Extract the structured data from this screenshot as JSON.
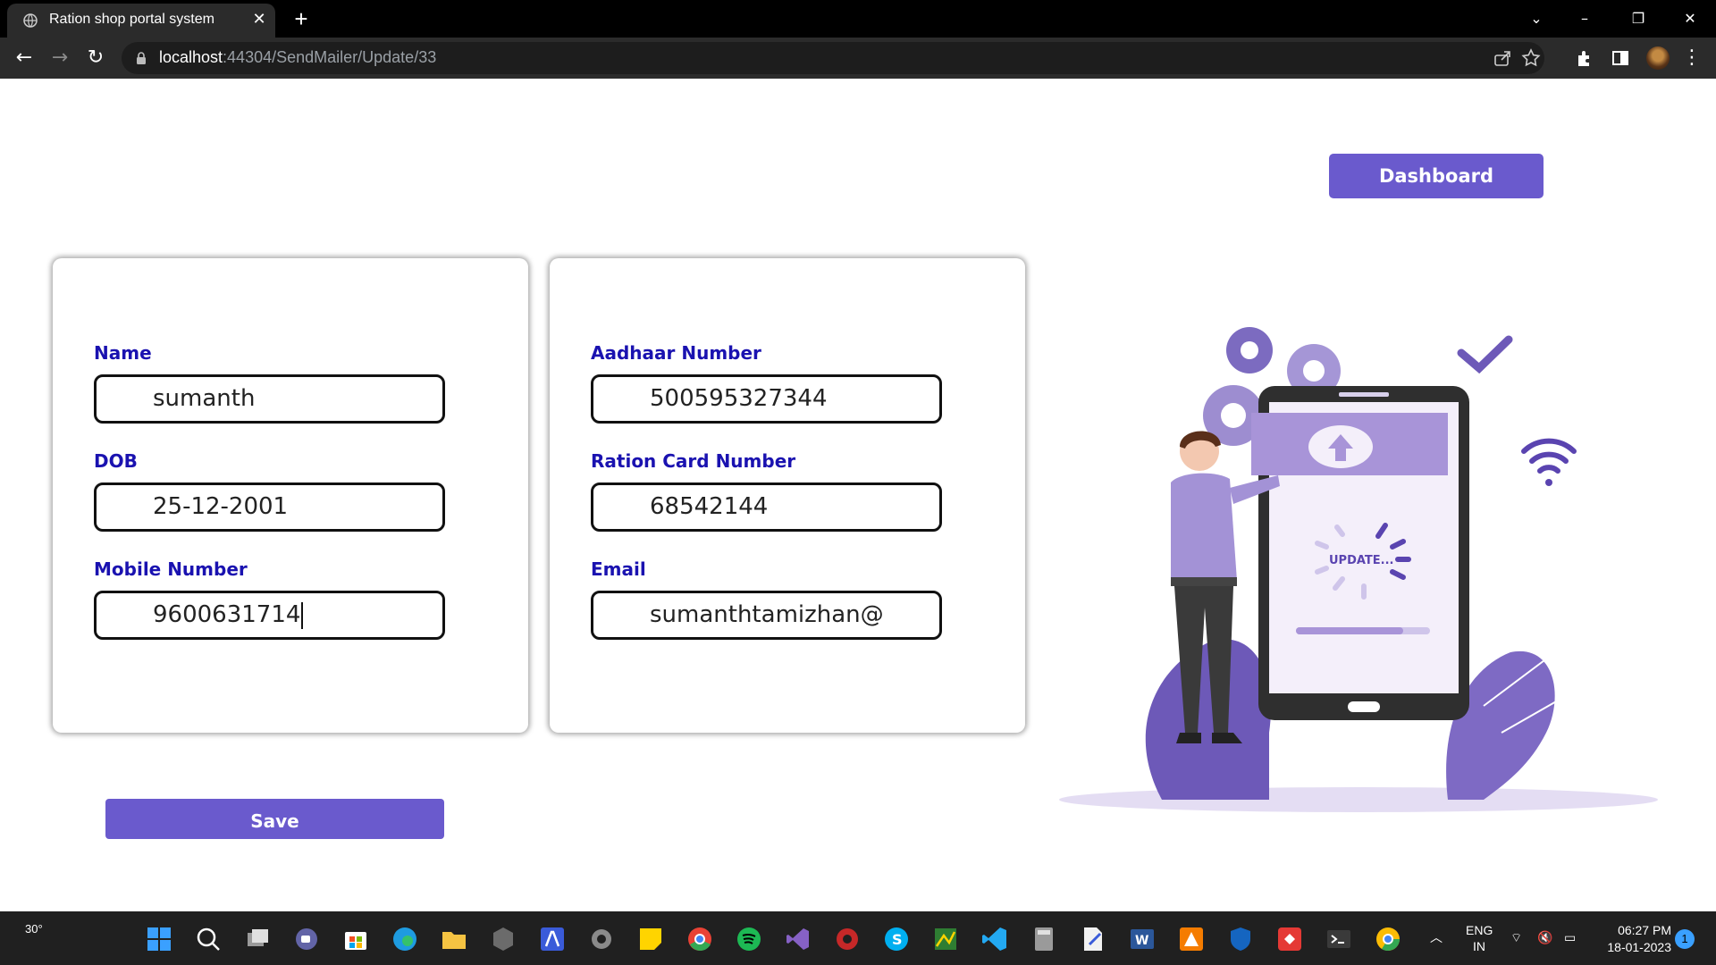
{
  "browser": {
    "tab_title": "Ration shop portal system",
    "url_host": "localhost",
    "url_rest": ":44304/SendMailer/Update/33"
  },
  "page": {
    "dashboard_label": "Dashboard",
    "save_label": "Save",
    "illustration_text": "UPDATE...",
    "left_card": {
      "name_label": "Name",
      "name_value": "sumanth",
      "dob_label": "DOB",
      "dob_value": "25-12-2001",
      "mobile_label": "Mobile Number",
      "mobile_value": "9600631714"
    },
    "right_card": {
      "aadhaar_label": "Aadhaar Number",
      "aadhaar_value": "500595327344",
      "ration_label": "Ration Card Number",
      "ration_value": "68542144",
      "email_label": "Email",
      "email_value": "sumanthtamizhan@"
    }
  },
  "taskbar": {
    "weather": "30°",
    "lang_top": "ENG",
    "lang_bottom": "IN",
    "time": "06:27 PM",
    "date": "18-01-2023",
    "notification_count": "1"
  },
  "colors": {
    "accent": "#6a5acd",
    "label": "#1a12b0",
    "illustration_purple": "#8e7cc3"
  }
}
